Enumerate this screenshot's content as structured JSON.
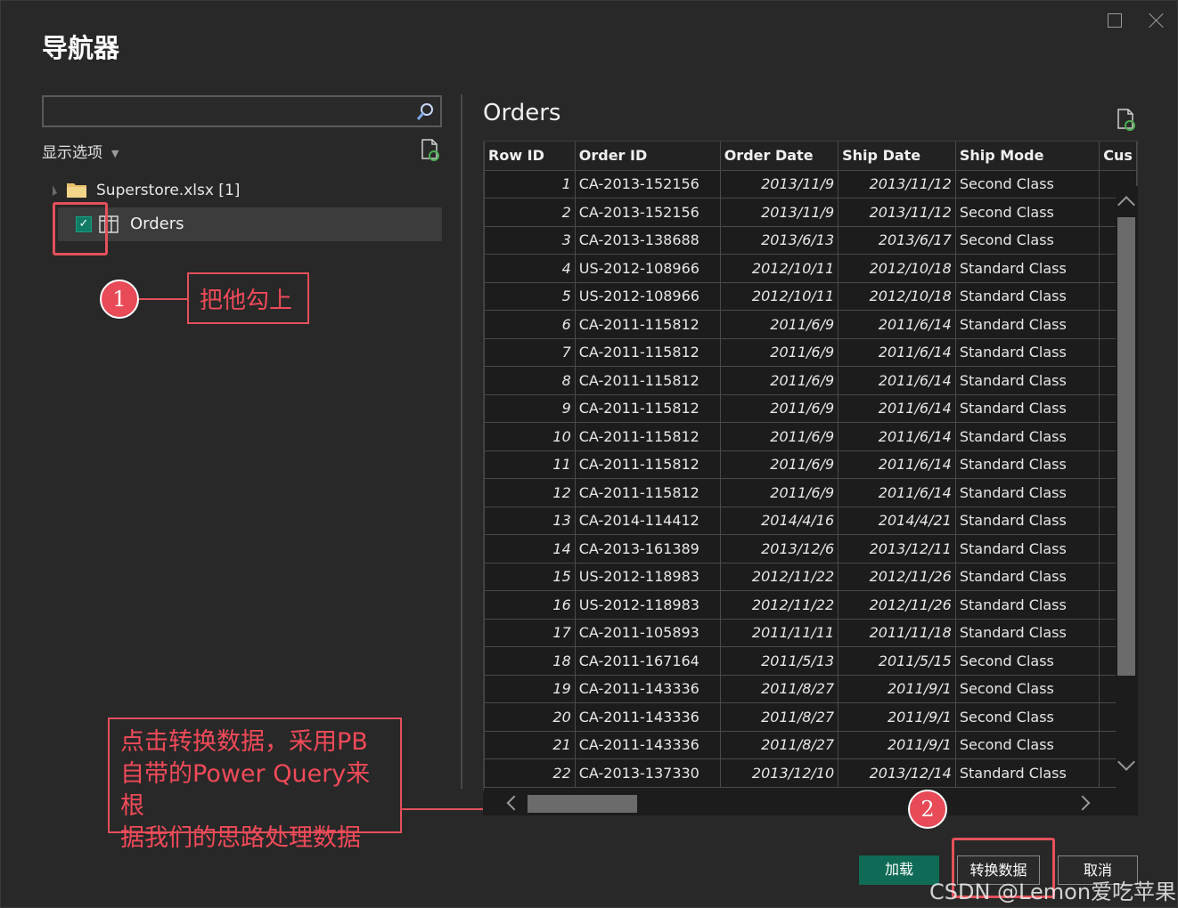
{
  "window": {
    "title": "导航器"
  },
  "left_pane": {
    "search": {
      "value": "",
      "placeholder": ""
    },
    "display_options_label": "显示选项",
    "tree": {
      "file_label": "Superstore.xlsx [1]",
      "items": [
        {
          "label": "Orders",
          "checked": true
        }
      ]
    }
  },
  "preview": {
    "title": "Orders",
    "columns": [
      "Row ID",
      "Order ID",
      "Order Date",
      "Ship Date",
      "Ship Mode",
      "Cus"
    ],
    "rows": [
      [
        "1",
        "CA-2013-152156",
        "2013/11/9",
        "2013/11/12",
        "Second Class"
      ],
      [
        "2",
        "CA-2013-152156",
        "2013/11/9",
        "2013/11/12",
        "Second Class"
      ],
      [
        "3",
        "CA-2013-138688",
        "2013/6/13",
        "2013/6/17",
        "Second Class"
      ],
      [
        "4",
        "US-2012-108966",
        "2012/10/11",
        "2012/10/18",
        "Standard Class"
      ],
      [
        "5",
        "US-2012-108966",
        "2012/10/11",
        "2012/10/18",
        "Standard Class"
      ],
      [
        "6",
        "CA-2011-115812",
        "2011/6/9",
        "2011/6/14",
        "Standard Class"
      ],
      [
        "7",
        "CA-2011-115812",
        "2011/6/9",
        "2011/6/14",
        "Standard Class"
      ],
      [
        "8",
        "CA-2011-115812",
        "2011/6/9",
        "2011/6/14",
        "Standard Class"
      ],
      [
        "9",
        "CA-2011-115812",
        "2011/6/9",
        "2011/6/14",
        "Standard Class"
      ],
      [
        "10",
        "CA-2011-115812",
        "2011/6/9",
        "2011/6/14",
        "Standard Class"
      ],
      [
        "11",
        "CA-2011-115812",
        "2011/6/9",
        "2011/6/14",
        "Standard Class"
      ],
      [
        "12",
        "CA-2011-115812",
        "2011/6/9",
        "2011/6/14",
        "Standard Class"
      ],
      [
        "13",
        "CA-2014-114412",
        "2014/4/16",
        "2014/4/21",
        "Standard Class"
      ],
      [
        "14",
        "CA-2013-161389",
        "2013/12/6",
        "2013/12/11",
        "Standard Class"
      ],
      [
        "15",
        "US-2012-118983",
        "2012/11/22",
        "2012/11/26",
        "Standard Class"
      ],
      [
        "16",
        "US-2012-118983",
        "2012/11/22",
        "2012/11/26",
        "Standard Class"
      ],
      [
        "17",
        "CA-2011-105893",
        "2011/11/11",
        "2011/11/18",
        "Standard Class"
      ],
      [
        "18",
        "CA-2011-167164",
        "2011/5/13",
        "2011/5/15",
        "Second Class"
      ],
      [
        "19",
        "CA-2011-143336",
        "2011/8/27",
        "2011/9/1",
        "Second Class"
      ],
      [
        "20",
        "CA-2011-143336",
        "2011/8/27",
        "2011/9/1",
        "Second Class"
      ],
      [
        "21",
        "CA-2011-143336",
        "2011/8/27",
        "2011/9/1",
        "Second Class"
      ],
      [
        "22",
        "CA-2013-137330",
        "2013/12/10",
        "2013/12/14",
        "Standard Class"
      ]
    ]
  },
  "buttons": {
    "load": "加载",
    "transform": "转换数据",
    "cancel": "取消"
  },
  "annotations": {
    "step1_number": "1",
    "step1_text": "把他勾上",
    "step2_number": "2",
    "step2_text_lines": [
      "点击转换数据，采用PB",
      "自带的Power Query来根",
      "据我们的思路处理数据"
    ]
  },
  "watermark": "CSDN @Lemon爱吃苹果",
  "colors": {
    "accent_green": "#0f6b55",
    "annotation_red": "#e5505a",
    "checkbox_green": "#107c66"
  },
  "icons": [
    "search-icon",
    "refresh-icon",
    "folder-icon",
    "table-icon",
    "checkmark-icon",
    "maximize-icon",
    "close-icon"
  ]
}
